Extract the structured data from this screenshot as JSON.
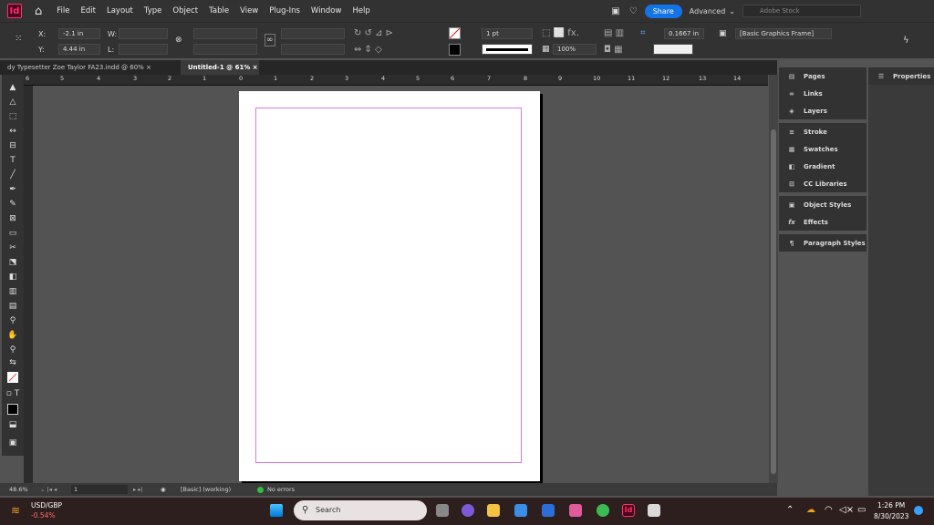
{
  "app": {
    "logo": "Id"
  },
  "menubar": {
    "items": [
      "File",
      "Edit",
      "Layout",
      "Type",
      "Object",
      "Table",
      "View",
      "Plug-Ins",
      "Window",
      "Help"
    ],
    "share_label": "Share",
    "workspace": "Advanced",
    "stock_placeholder": "Adobe Stock"
  },
  "control": {
    "x_label": "X:",
    "x_value": "-2.1 in",
    "y_label": "Y:",
    "y_value": "4.44 in",
    "w_label": "W:",
    "h_label": "L:",
    "stroke_weight": "1 pt",
    "opacity": "100%",
    "offset": "0.1667 in",
    "object_style": "[Basic Graphics Frame]"
  },
  "tabs": [
    {
      "label": "dy Typesetter Zoe Taylor FA23.indd @ 60%"
    },
    {
      "label": "Untitled-1 @ 61%"
    }
  ],
  "ruler": {
    "labels": [
      "6",
      "5",
      "4",
      "3",
      "2",
      "1",
      "0",
      "1",
      "2",
      "3",
      "4",
      "5",
      "6",
      "7",
      "8",
      "9",
      "10",
      "11",
      "12",
      "13",
      "14"
    ]
  },
  "status": {
    "zoom": "48.6%",
    "page": "1",
    "style": "[Basic] (working)",
    "errors": "No errors"
  },
  "panels": {
    "group1": [
      {
        "label": "Pages",
        "icon": "pages-icon"
      },
      {
        "label": "Links",
        "icon": "links-icon"
      },
      {
        "label": "Layers",
        "icon": "layers-icon"
      }
    ],
    "group2": [
      {
        "label": "Stroke",
        "icon": "stroke-icon"
      },
      {
        "label": "Swatches",
        "icon": "swatches-icon"
      },
      {
        "label": "Gradient",
        "icon": "gradient-icon"
      },
      {
        "label": "CC Libraries",
        "icon": "cc-libraries-icon"
      }
    ],
    "group3": [
      {
        "label": "Object Styles",
        "icon": "object-styles-icon"
      },
      {
        "label": "Effects",
        "icon": "fx-icon"
      }
    ],
    "group4": [
      {
        "label": "Paragraph Styles",
        "icon": "paragraph-styles-icon"
      }
    ],
    "properties_label": "Properties"
  },
  "taskbar": {
    "currency": "USD/GBP",
    "change": "-0.54%",
    "search_placeholder": "Search",
    "time": "1:26 PM",
    "date": "8/30/2023"
  },
  "colors": {
    "accent": "#1473e6",
    "margin_guide": "#d67ae6",
    "indesign": "#ff3366"
  }
}
